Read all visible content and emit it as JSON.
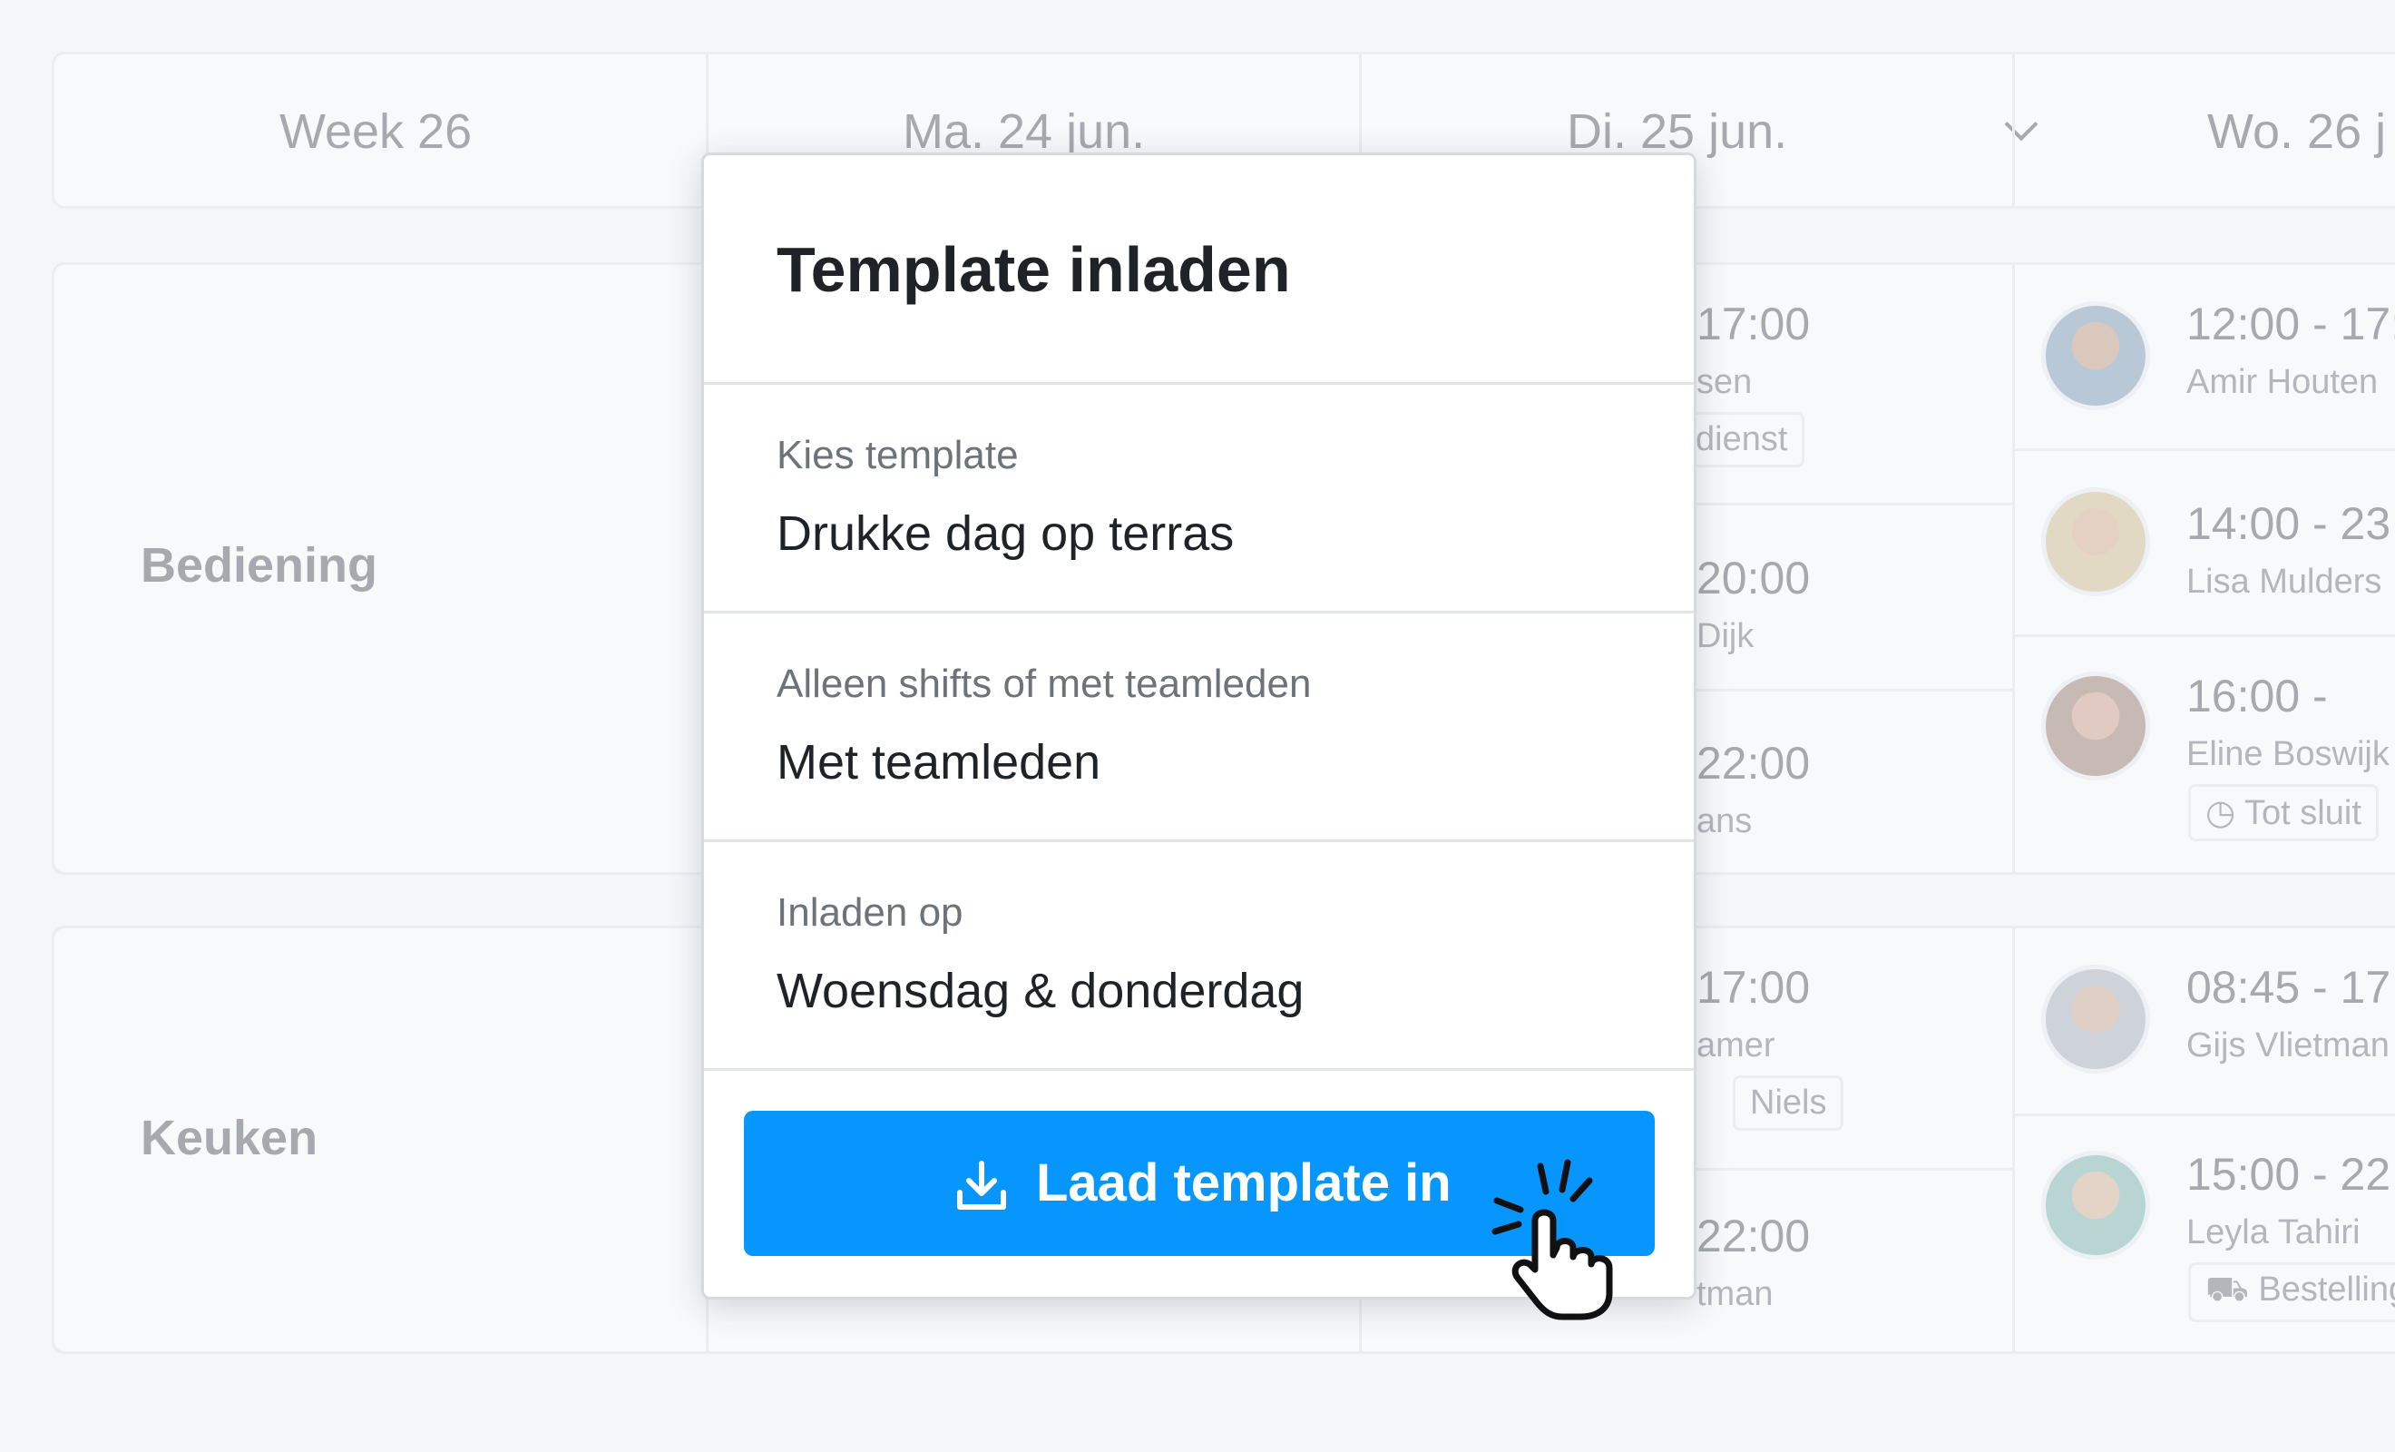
{
  "week_header": {
    "week": "Week 26",
    "days": [
      "Ma. 24 jun.",
      "Di. 25 jun.",
      "Wo. 26 j"
    ]
  },
  "sections": [
    {
      "label": "Bediening"
    },
    {
      "label": "Keuken"
    }
  ],
  "background_fragments": {
    "tuesday": {
      "s1": {
        "time": "17:00",
        "name": "sen",
        "tag": "dienst"
      },
      "s2": {
        "time": "20:00",
        "name": "Dijk"
      },
      "s3": {
        "time": "22:00",
        "name": "ans"
      },
      "k1": {
        "time": "17:00",
        "name": "amer",
        "tag": "Niels"
      },
      "k2": {
        "time": "22:00",
        "name": "tman"
      }
    },
    "wednesday": {
      "s1": {
        "time": "12:00 - 17:",
        "name": "Amir Houten"
      },
      "s2": {
        "time": "14:00 - 23",
        "name": "Lisa Mulders"
      },
      "s3": {
        "time": "16:00 -",
        "name": "Eline Boswijk",
        "tag": "Tot sluit"
      },
      "k1": {
        "time": "08:45 - 17",
        "name": "Gijs Vlietman"
      },
      "k2": {
        "time": "15:00 - 22",
        "name": "Leyla Tahiri",
        "tag": "Bestelling"
      }
    }
  },
  "modal": {
    "title": "Template inladen",
    "fields": [
      {
        "label": "Kies template",
        "value": "Drukke dag op terras"
      },
      {
        "label": "Alleen shifts of met teamleden",
        "value": "Met teamleden"
      },
      {
        "label": "Inladen op",
        "value": "Woensdag & donderdag"
      }
    ],
    "button_label": "Laad template in",
    "button_icon": "download-icon",
    "accent_color": "#0795fe"
  }
}
